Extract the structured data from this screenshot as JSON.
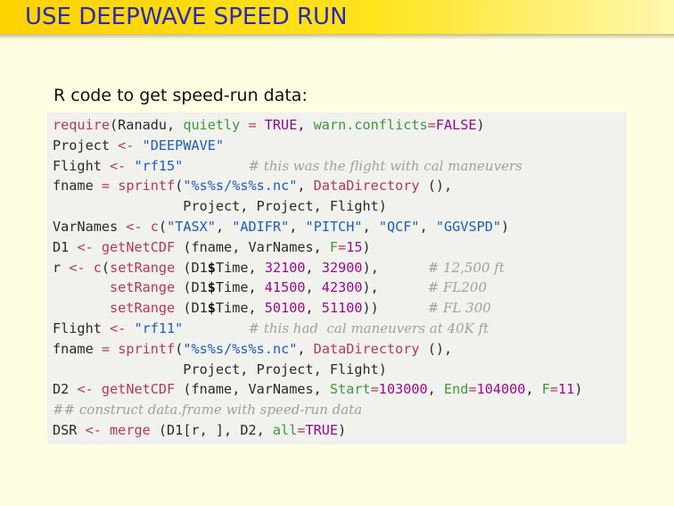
{
  "slide": {
    "title": "USE DEEPWAVE SPEED RUN",
    "subtitle": "R code to get speed-run data:"
  },
  "code": {
    "lines": [
      [
        {
          "t": "require",
          "c": "fn"
        },
        {
          "t": "(Ranadu, ",
          "c": "plain"
        },
        {
          "t": "quietly",
          "c": "arg"
        },
        {
          "t": " = ",
          "c": "op"
        },
        {
          "t": "TRUE",
          "c": "const"
        },
        {
          "t": ", ",
          "c": "plain"
        },
        {
          "t": "warn.conflicts",
          "c": "arg"
        },
        {
          "t": "=",
          "c": "op"
        },
        {
          "t": "FALSE",
          "c": "const"
        },
        {
          "t": ")",
          "c": "plain"
        }
      ],
      [
        {
          "t": "Project ",
          "c": "plain"
        },
        {
          "t": "<-",
          "c": "op"
        },
        {
          "t": " ",
          "c": "plain"
        },
        {
          "t": "\"DEEPWAVE\"",
          "c": "str"
        }
      ],
      [
        {
          "t": "Flight ",
          "c": "plain"
        },
        {
          "t": "<-",
          "c": "op"
        },
        {
          "t": " ",
          "c": "plain"
        },
        {
          "t": "\"rf15\"",
          "c": "str"
        },
        {
          "t": "        ",
          "c": "plain"
        },
        {
          "t": "# this was the flight with cal maneuvers",
          "c": "cmt"
        }
      ],
      [
        {
          "t": "fname ",
          "c": "plain"
        },
        {
          "t": "=",
          "c": "op"
        },
        {
          "t": " ",
          "c": "plain"
        },
        {
          "t": "sprintf",
          "c": "fn"
        },
        {
          "t": "(",
          "c": "plain"
        },
        {
          "t": "\"%s%s/%s%s.nc\"",
          "c": "str"
        },
        {
          "t": ", ",
          "c": "plain"
        },
        {
          "t": "DataDirectory",
          "c": "fn"
        },
        {
          "t": " (),",
          "c": "plain"
        }
      ],
      [
        {
          "t": "                Project, Project, Flight)",
          "c": "plain"
        }
      ],
      [
        {
          "t": "VarNames ",
          "c": "plain"
        },
        {
          "t": "<-",
          "c": "op"
        },
        {
          "t": " ",
          "c": "plain"
        },
        {
          "t": "c",
          "c": "fn"
        },
        {
          "t": "(",
          "c": "plain"
        },
        {
          "t": "\"TASX\"",
          "c": "str"
        },
        {
          "t": ", ",
          "c": "plain"
        },
        {
          "t": "\"ADIFR\"",
          "c": "str"
        },
        {
          "t": ", ",
          "c": "plain"
        },
        {
          "t": "\"PITCH\"",
          "c": "str"
        },
        {
          "t": ", ",
          "c": "plain"
        },
        {
          "t": "\"QCF\"",
          "c": "str"
        },
        {
          "t": ", ",
          "c": "plain"
        },
        {
          "t": "\"GGVSPD\"",
          "c": "str"
        },
        {
          "t": ")",
          "c": "plain"
        }
      ],
      [
        {
          "t": "D1 ",
          "c": "plain"
        },
        {
          "t": "<-",
          "c": "op"
        },
        {
          "t": " ",
          "c": "plain"
        },
        {
          "t": "getNetCDF",
          "c": "fn"
        },
        {
          "t": " (fname, VarNames, ",
          "c": "plain"
        },
        {
          "t": "F",
          "c": "arg"
        },
        {
          "t": "=",
          "c": "op"
        },
        {
          "t": "15",
          "c": "num"
        },
        {
          "t": ")",
          "c": "plain"
        }
      ],
      [
        {
          "t": "r ",
          "c": "plain"
        },
        {
          "t": "<-",
          "c": "op"
        },
        {
          "t": " ",
          "c": "plain"
        },
        {
          "t": "c",
          "c": "fn"
        },
        {
          "t": "(",
          "c": "plain"
        },
        {
          "t": "setRange",
          "c": "fn"
        },
        {
          "t": " (D1",
          "c": "plain"
        },
        {
          "t": "$",
          "c": "dollar"
        },
        {
          "t": "Time, ",
          "c": "plain"
        },
        {
          "t": "32100",
          "c": "num"
        },
        {
          "t": ", ",
          "c": "plain"
        },
        {
          "t": "32900",
          "c": "num"
        },
        {
          "t": "),      ",
          "c": "plain"
        },
        {
          "t": "# 12,500 ft",
          "c": "cmt"
        }
      ],
      [
        {
          "t": "       ",
          "c": "plain"
        },
        {
          "t": "setRange",
          "c": "fn"
        },
        {
          "t": " (D1",
          "c": "plain"
        },
        {
          "t": "$",
          "c": "dollar"
        },
        {
          "t": "Time, ",
          "c": "plain"
        },
        {
          "t": "41500",
          "c": "num"
        },
        {
          "t": ", ",
          "c": "plain"
        },
        {
          "t": "42300",
          "c": "num"
        },
        {
          "t": "),      ",
          "c": "plain"
        },
        {
          "t": "# FL200",
          "c": "cmt"
        }
      ],
      [
        {
          "t": "       ",
          "c": "plain"
        },
        {
          "t": "setRange",
          "c": "fn"
        },
        {
          "t": " (D1",
          "c": "plain"
        },
        {
          "t": "$",
          "c": "dollar"
        },
        {
          "t": "Time, ",
          "c": "plain"
        },
        {
          "t": "50100",
          "c": "num"
        },
        {
          "t": ", ",
          "c": "plain"
        },
        {
          "t": "51100",
          "c": "num"
        },
        {
          "t": "))      ",
          "c": "plain"
        },
        {
          "t": "# FL 300",
          "c": "cmt"
        }
      ],
      [
        {
          "t": "Flight ",
          "c": "plain"
        },
        {
          "t": "<-",
          "c": "op"
        },
        {
          "t": " ",
          "c": "plain"
        },
        {
          "t": "\"rf11\"",
          "c": "str"
        },
        {
          "t": "        ",
          "c": "plain"
        },
        {
          "t": "# this had  cal maneuvers at 40K ft",
          "c": "cmt"
        }
      ],
      [
        {
          "t": "fname ",
          "c": "plain"
        },
        {
          "t": "=",
          "c": "op"
        },
        {
          "t": " ",
          "c": "plain"
        },
        {
          "t": "sprintf",
          "c": "fn"
        },
        {
          "t": "(",
          "c": "plain"
        },
        {
          "t": "\"%s%s/%s%s.nc\"",
          "c": "str"
        },
        {
          "t": ", ",
          "c": "plain"
        },
        {
          "t": "DataDirectory",
          "c": "fn"
        },
        {
          "t": " (),",
          "c": "plain"
        }
      ],
      [
        {
          "t": "                Project, Project, Flight)",
          "c": "plain"
        }
      ],
      [
        {
          "t": "D2 ",
          "c": "plain"
        },
        {
          "t": "<-",
          "c": "op"
        },
        {
          "t": " ",
          "c": "plain"
        },
        {
          "t": "getNetCDF",
          "c": "fn"
        },
        {
          "t": " (fname, VarNames, ",
          "c": "plain"
        },
        {
          "t": "Start",
          "c": "arg"
        },
        {
          "t": "=",
          "c": "op"
        },
        {
          "t": "103000",
          "c": "num"
        },
        {
          "t": ", ",
          "c": "plain"
        },
        {
          "t": "End",
          "c": "arg"
        },
        {
          "t": "=",
          "c": "op"
        },
        {
          "t": "104000",
          "c": "num"
        },
        {
          "t": ", ",
          "c": "plain"
        },
        {
          "t": "F",
          "c": "arg"
        },
        {
          "t": "=",
          "c": "op"
        },
        {
          "t": "11",
          "c": "num"
        },
        {
          "t": ")",
          "c": "plain"
        }
      ],
      [
        {
          "t": "## construct data.frame with speed-run data",
          "c": "cmt"
        }
      ],
      [
        {
          "t": "DSR ",
          "c": "plain"
        },
        {
          "t": "<-",
          "c": "op"
        },
        {
          "t": " ",
          "c": "plain"
        },
        {
          "t": "merge",
          "c": "fn"
        },
        {
          "t": " (D1[r, ], D2, ",
          "c": "plain"
        },
        {
          "t": "all",
          "c": "arg"
        },
        {
          "t": "=",
          "c": "op"
        },
        {
          "t": "TRUE",
          "c": "const"
        },
        {
          "t": ")",
          "c": "plain"
        }
      ]
    ]
  }
}
